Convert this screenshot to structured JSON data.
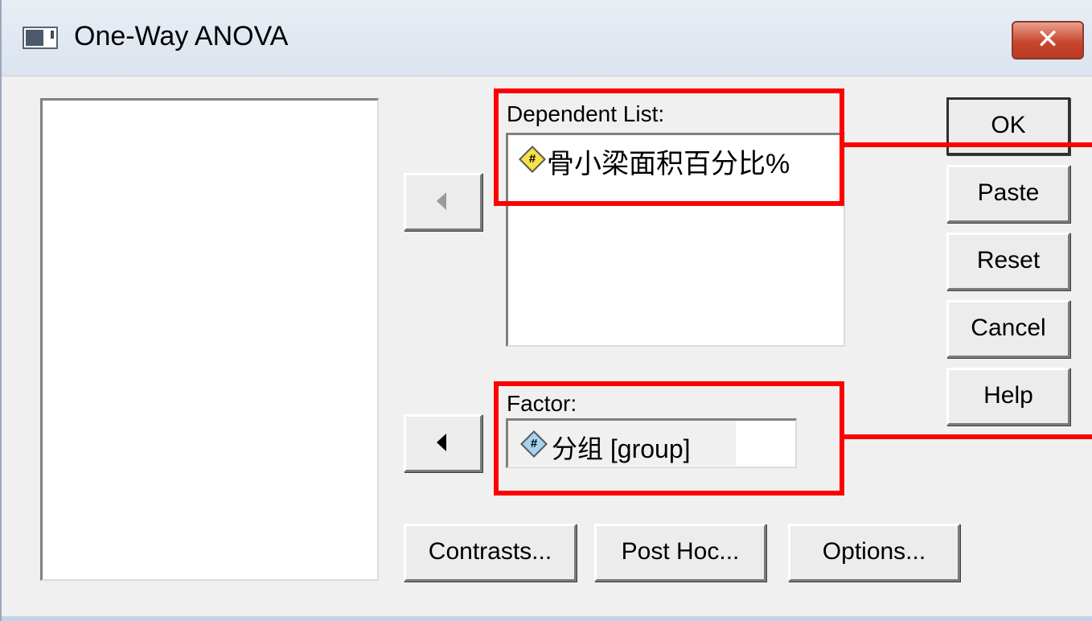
{
  "window": {
    "title": "One-Way ANOVA",
    "close_glyph": "✕"
  },
  "dependent": {
    "label": "Dependent List:",
    "items": [
      {
        "name": "骨小梁面积百分比%",
        "icon": "scale-variable-icon"
      }
    ]
  },
  "factor": {
    "label": "Factor:",
    "value": "分组 [group]",
    "icon": "nominal-variable-icon"
  },
  "buttons": {
    "ok": "OK",
    "paste": "Paste",
    "reset": "Reset",
    "cancel": "Cancel",
    "help": "Help",
    "contrasts": "Contrasts...",
    "post_hoc": "Post Hoc...",
    "options": "Options..."
  },
  "colors": {
    "highlight": "#ff0000",
    "titlebar": "#dbe3ee",
    "dialog": "#f0f0f0"
  }
}
